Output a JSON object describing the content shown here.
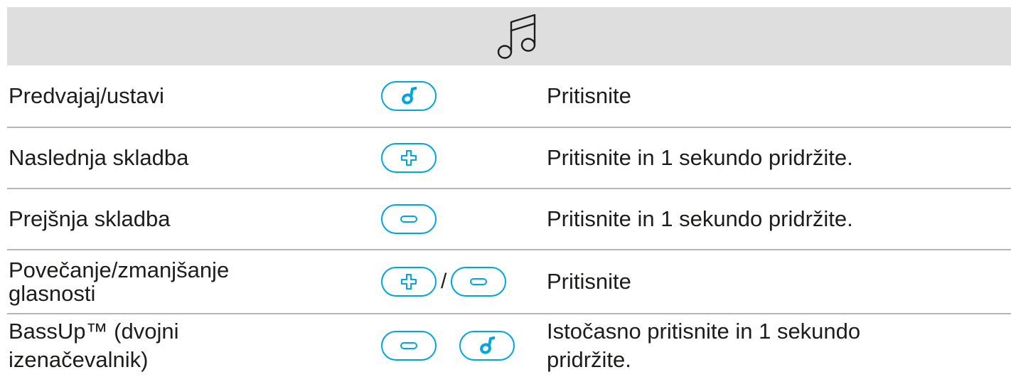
{
  "header": {
    "icon": "music-note-icon"
  },
  "colors": {
    "accent": "#00a6e0",
    "header_bg": "#dedede",
    "divider": "#b5b5b5",
    "text": "#1d1d1b"
  },
  "rows": [
    {
      "function": "Predvajaj/ustavi",
      "keys": [
        "play-pause-icon"
      ],
      "operation": "Pritisnite"
    },
    {
      "function": "Naslednja skladba",
      "keys": [
        "plus-icon"
      ],
      "operation": "Pritisnite in 1 sekundo pridržite."
    },
    {
      "function": "Prejšnja skladba",
      "keys": [
        "minus-icon"
      ],
      "operation": "Pritisnite in 1 sekundo pridržite."
    },
    {
      "function": "Povečanje/zmanjšanje\nglasnosti",
      "keys": [
        "plus-icon",
        "minus-icon"
      ],
      "key_separator": "/",
      "operation": "Pritisnite"
    },
    {
      "function": "BassUp™ (dvojni\nizenačevalnik)",
      "keys": [
        "minus-icon",
        "play-pause-icon"
      ],
      "operation": "Istočasno pritisnite in 1 sekundo\npridržite."
    }
  ]
}
